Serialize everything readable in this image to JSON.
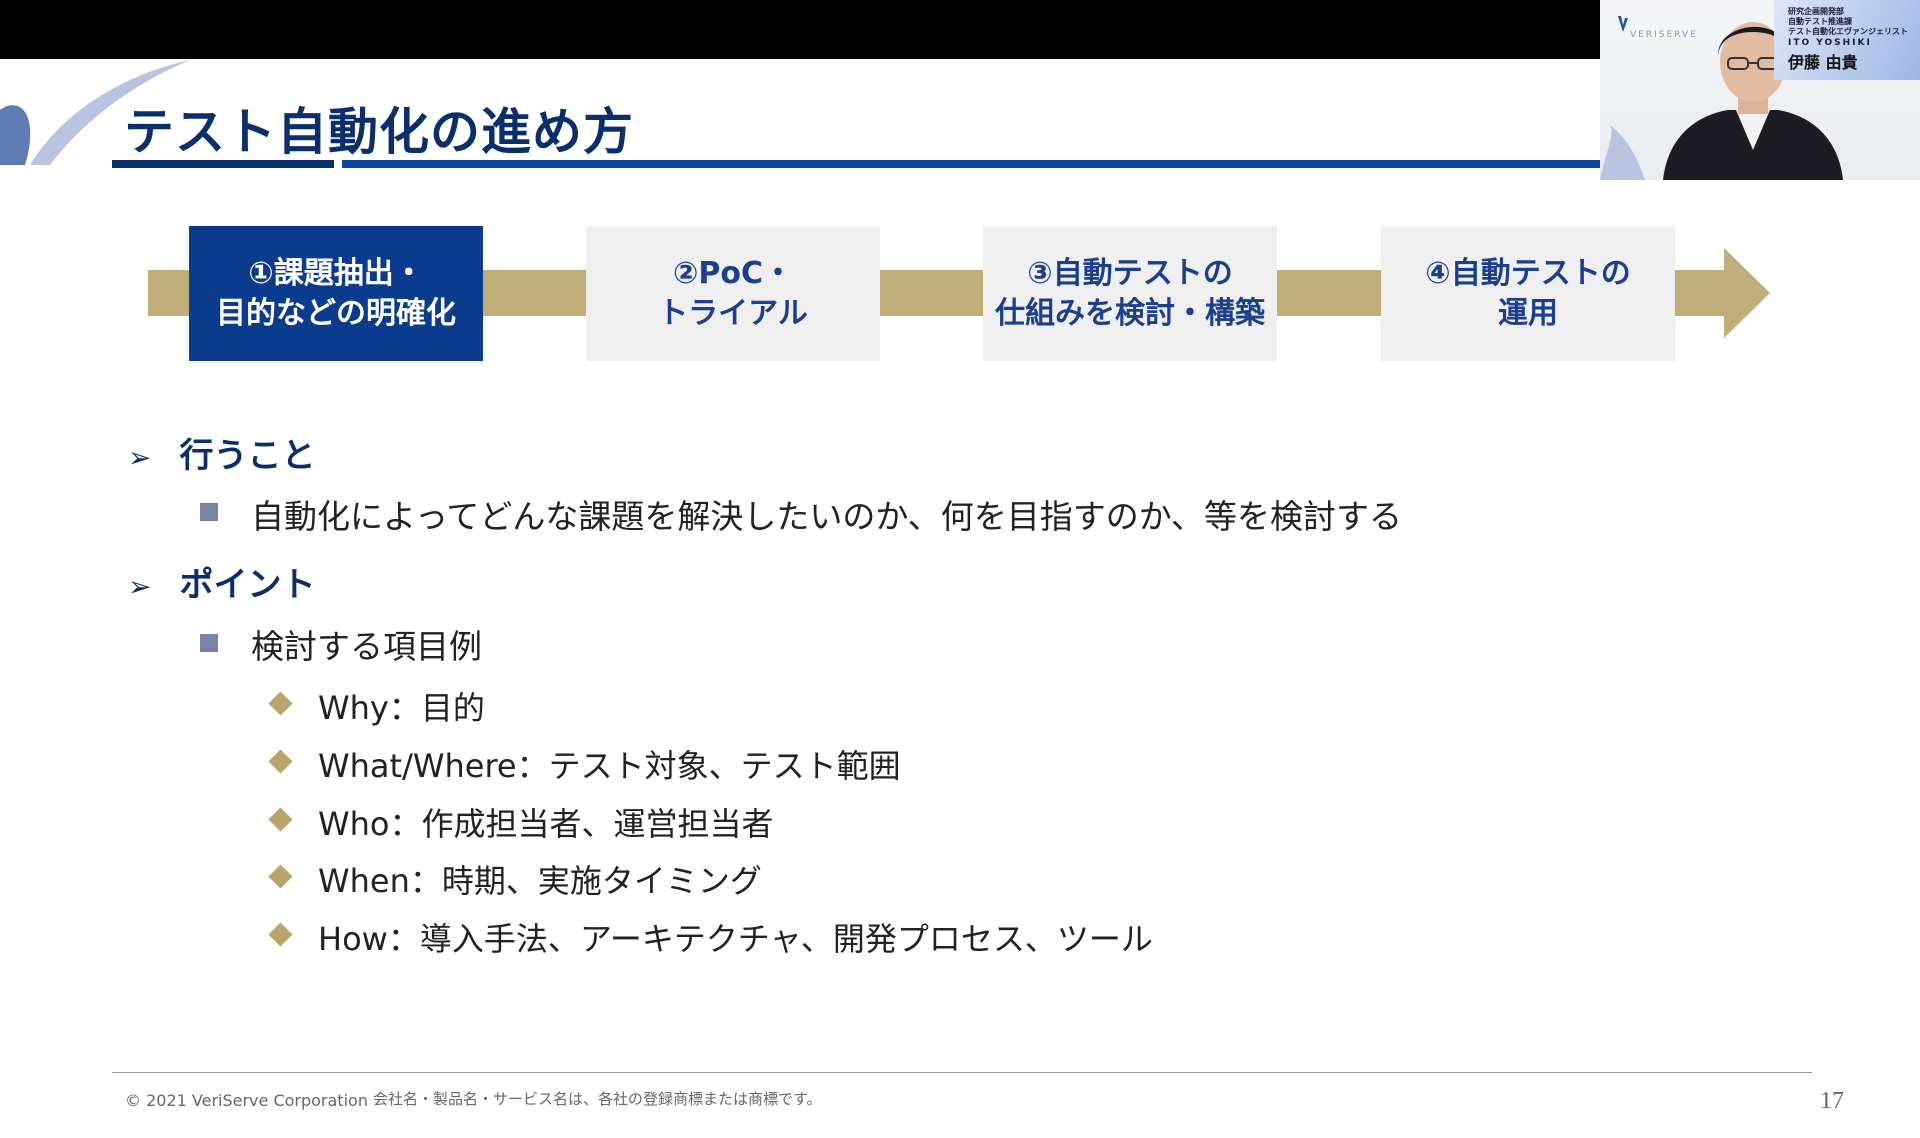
{
  "slide": {
    "title": "テスト自動化の進め方",
    "steps": [
      {
        "line1": "①課題抽出・",
        "line2": "目的などの明確化",
        "active": true
      },
      {
        "line1": "②PoC・",
        "line2": "トライアル",
        "active": false
      },
      {
        "line1": "③自動テストの",
        "line2": "仕組みを検討・構築",
        "active": false
      },
      {
        "line1": "④自動テストの",
        "line2": "運用",
        "active": false
      }
    ],
    "sections": {
      "todo_heading": "行うこと",
      "todo_item": "自動化によってどんな課題を解決したいのか、何を目指すのか、等を検討する",
      "points_heading": "ポイント",
      "points_sub": "検討する項目例",
      "points_items": [
        "Why：目的",
        "What/Where：テスト対象、テスト範囲",
        "Who：作成担当者、運営担当者",
        "When：時期、実施タイミング",
        "How：導入手法、アーキテクチャ、開発プロセス、ツール"
      ]
    },
    "footer": {
      "copyright": "© 2021 VeriServe Corporation",
      "notice": "会社名・製品名・サービス名は、各社の登録商標または商標です。",
      "page": "17"
    }
  },
  "webcam": {
    "logo": "VERISERVE",
    "namecard": {
      "dept": "研究企画開発部",
      "team": "自動テスト推進課",
      "role": "テスト自動化エヴァンジェリスト",
      "name_en": "ITO YOSHIKI",
      "name_jp": "伊藤 由貴"
    }
  },
  "colors": {
    "navy": "#0b2f6b",
    "active_step": "#0b3b8c",
    "gold_arrow": "#bfae7a",
    "bullet_square": "#7784a8",
    "bullet_diamond": "#b8a56b"
  }
}
